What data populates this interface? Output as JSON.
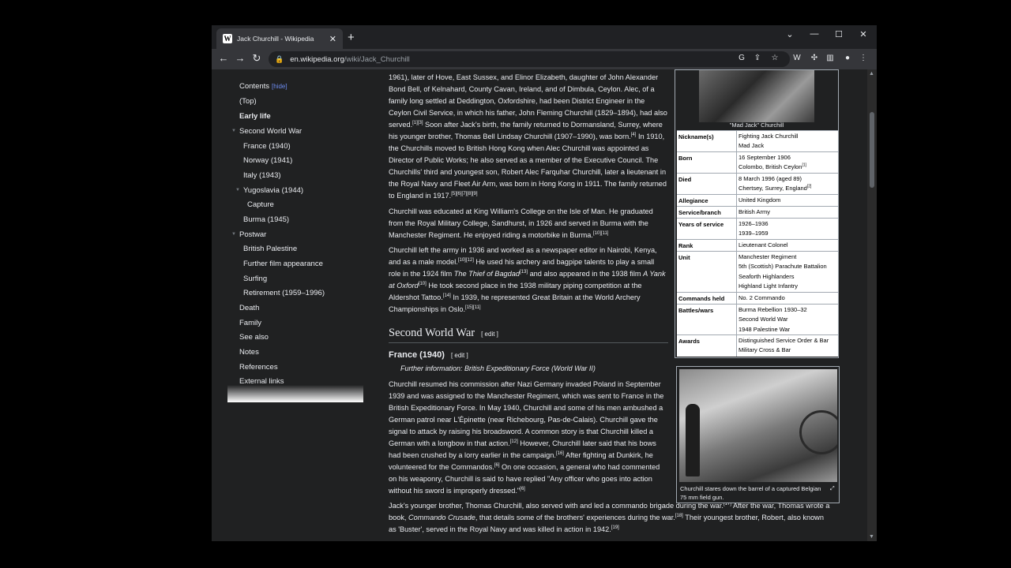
{
  "browser": {
    "tab_title": "Jack Churchill - Wikipedia",
    "tab_favicon": "W",
    "url_domain": "en.wikipedia.org",
    "url_path": "/wiki/Jack_Churchill"
  },
  "toc": {
    "title": "Contents",
    "hide": "[hide]",
    "items": [
      {
        "label": "(Top)"
      },
      {
        "label": "Early life"
      },
      {
        "label": "Second World War"
      },
      {
        "label": "France (1940)"
      },
      {
        "label": "Norway (1941)"
      },
      {
        "label": "Italy (1943)"
      },
      {
        "label": "Yugoslavia (1944)"
      },
      {
        "label": "Capture"
      },
      {
        "label": "Burma (1945)"
      },
      {
        "label": "Postwar"
      },
      {
        "label": "British Palestine"
      },
      {
        "label": "Further film appearance"
      },
      {
        "label": "Surfing"
      },
      {
        "label": "Retirement (1959–1996)"
      },
      {
        "label": "Death"
      },
      {
        "label": "Family"
      },
      {
        "label": "See also"
      },
      {
        "label": "Notes"
      },
      {
        "label": "References"
      },
      {
        "label": "External links"
      }
    ]
  },
  "article": {
    "para1_a": "1961), later of Hove, East Sussex, and Elinor Elizabeth, daughter of John Alexander Bond Bell, of Kelnahard, County Cavan, Ireland, and of Dimbula, Ceylon. Alec, of a family long settled at Deddington, Oxfordshire, had been District Engineer in the Ceylon Civil Service, in which his father, John Fleming Churchill (1829–1894), had also served.",
    "para1_ref1": "[1][3]",
    "para1_b": " Soon after Jack's birth, the family returned to Dormansland, Surrey, where his younger brother, Thomas Bell Lindsay Churchill (1907–1990), was born.",
    "para1_ref2": "[4]",
    "para1_c": " In 1910, the Churchills moved to British Hong Kong when Alec Churchill was appointed as Director of Public Works; he also served as a member of the Executive Council. The Churchills' third and youngest son, Robert Alec Farquhar Churchill, later a lieutenant in the Royal Navy and Fleet Air Arm, was born in Hong Kong in 1911. The family returned to England in 1917.",
    "para1_ref3": "[5][6][7][8][9]",
    "para2_a": "Churchill was educated at King William's College on the Isle of Man. He graduated from the Royal Military College, Sandhurst, in 1926 and served in Burma with the Manchester Regiment. He enjoyed riding a motorbike in Burma.",
    "para2_ref": "[10][11]",
    "para3_a": "Churchill left the army in 1936 and worked as a newspaper editor in Nairobi, Kenya, and as a male model.",
    "para3_ref1": "[10][12]",
    "para3_b": " He used his archery and bagpipe talents to play a small role in the 1924 film ",
    "para3_film1": "The Thief of Bagdad",
    "para3_ref2": "[13]",
    "para3_c": " and also appeared in the 1938 film ",
    "para3_film2": "A Yank at Oxford",
    "para3_ref3": "[10]",
    "para3_d": " He took second place in the 1938 military piping competition at the Aldershot Tattoo.",
    "para3_ref4": "[14]",
    "para3_e": " In 1939, he represented Great Britain at the World Archery Championships in Oslo.",
    "para3_ref5": "[15][11]",
    "h2_ww2": "Second World War",
    "edit_label": "[ edit ]",
    "h3_france": "France (1940)",
    "hatnote": "Further information: British Expeditionary Force (World War II)",
    "para4_a": "Churchill resumed his commission after Nazi Germany invaded Poland in September 1939 and was assigned to the Manchester Regiment, which was sent to France in the British Expeditionary Force. In May 1940, Churchill and some of his men ambushed a German patrol near L'Épinette (near Richebourg, Pas-de-Calais). Churchill gave the signal to attack by raising his broadsword. A common story is that Churchill killed a German with a longbow in that action.",
    "para4_ref1": "[12]",
    "para4_b": " However, Churchill later said that his bows had been crushed by a lorry earlier in the campaign.",
    "para4_ref2": "[16]",
    "para4_c": " After fighting at Dunkirk, he volunteered for the Commandos.",
    "para4_ref3": "[6]",
    "para4_d": " On one occasion, a general who had commented on his weaponry, Churchill is said to have replied \"Any officer who goes into action without his sword is improperly dressed.\"",
    "para4_ref4": "[6]",
    "para5_a": "Jack's younger brother, Thomas Churchill, also served with and led a commando brigade during the war.",
    "para5_ref1": "[17]",
    "para5_b": " After the war, Thomas wrote a book, ",
    "para5_book": "Commando Crusade",
    "para5_c": ", that details some of the brothers' experiences during the war.",
    "para5_ref2": "[18]",
    "para5_d": " Their youngest brother, Robert, also known as 'Buster', served in the Royal Navy and was killed in action in 1942.",
    "para5_ref3": "[19]"
  },
  "infobox": {
    "caption": "\"Mad Jack\" Churchill",
    "rows": [
      {
        "label": "Nickname(s)",
        "lines": [
          "Fighting Jack Churchill",
          "Mad Jack"
        ]
      },
      {
        "label": "Born",
        "lines": [
          "16 September 1906",
          "Colombo, British Ceylon"
        ],
        "ref": "[1]"
      },
      {
        "label": "Died",
        "lines": [
          "8 March 1996 (aged 89)",
          "Chertsey, Surrey, England"
        ],
        "ref": "[2]"
      },
      {
        "label": "Allegiance",
        "lines": [
          "United Kingdom"
        ]
      },
      {
        "label": "Service/branch",
        "lines": [
          "British Army"
        ]
      },
      {
        "label": "Years of service",
        "lines": [
          "1926–1936",
          "1939–1959"
        ]
      },
      {
        "label": "Rank",
        "lines": [
          "Lieutenant Colonel"
        ]
      },
      {
        "label": "Unit",
        "lines": [
          "Manchester Regiment",
          "5th (Scottish) Parachute Battalion",
          "Seaforth Highlanders",
          "Highland Light Infantry"
        ]
      },
      {
        "label": "Commands held",
        "lines": [
          "No. 2 Commando"
        ]
      },
      {
        "label": "Battles/wars",
        "lines": [
          "Burma Rebellion 1930–32",
          "Second World War",
          "1948 Palestine War"
        ]
      },
      {
        "label": "Awards",
        "lines": [
          "Distinguished Service Order & Bar",
          "Military Cross & Bar"
        ]
      }
    ]
  },
  "photo": {
    "caption": "Churchill stares down the barrel of a captured Belgian 75 mm field gun."
  },
  "icons": {
    "back": "arrow-left-icon",
    "forward": "arrow-right-icon",
    "reload": "reload-icon",
    "lock": "lock-icon"
  }
}
